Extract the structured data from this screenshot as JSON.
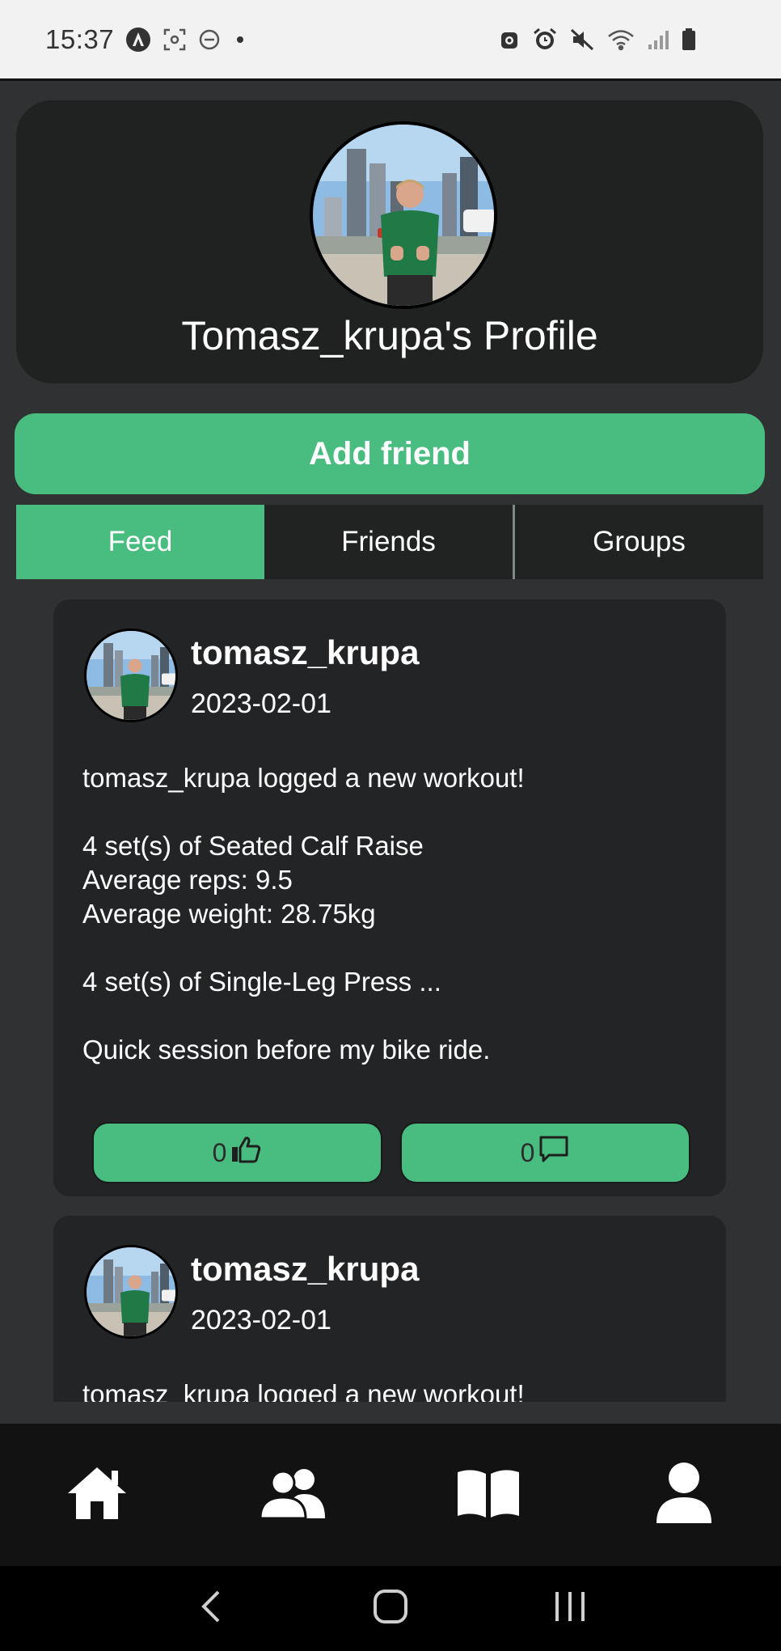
{
  "status_bar": {
    "time": "15:37"
  },
  "profile": {
    "title": "Tomasz_krupa's Profile",
    "add_friend_label": "Add friend"
  },
  "tabs": [
    {
      "label": "Feed",
      "active": true
    },
    {
      "label": "Friends",
      "active": false
    },
    {
      "label": "Groups",
      "active": false
    }
  ],
  "feed": [
    {
      "username": "tomasz_krupa",
      "date": "2023-02-01",
      "lines": [
        "tomasz_krupa logged a new workout!",
        "",
        "4 set(s) of Seated Calf Raise",
        "Average reps: 9.5",
        "Average weight: 28.75kg",
        "",
        "4 set(s) of Single-Leg Press ...",
        "",
        "Quick session before my bike ride."
      ],
      "likes": "0",
      "comments": "0"
    },
    {
      "username": "tomasz_krupa",
      "date": "2023-02-01",
      "lines": [
        "tomasz_krupa logged a new workout!"
      ]
    }
  ],
  "bottom_nav": [
    {
      "icon": "home-icon"
    },
    {
      "icon": "friends-icon"
    },
    {
      "icon": "book-icon"
    },
    {
      "icon": "profile-icon"
    }
  ],
  "colors": {
    "accent": "#49bd80",
    "background": "#2f3133",
    "card": "#232426",
    "nav": "#121212"
  }
}
